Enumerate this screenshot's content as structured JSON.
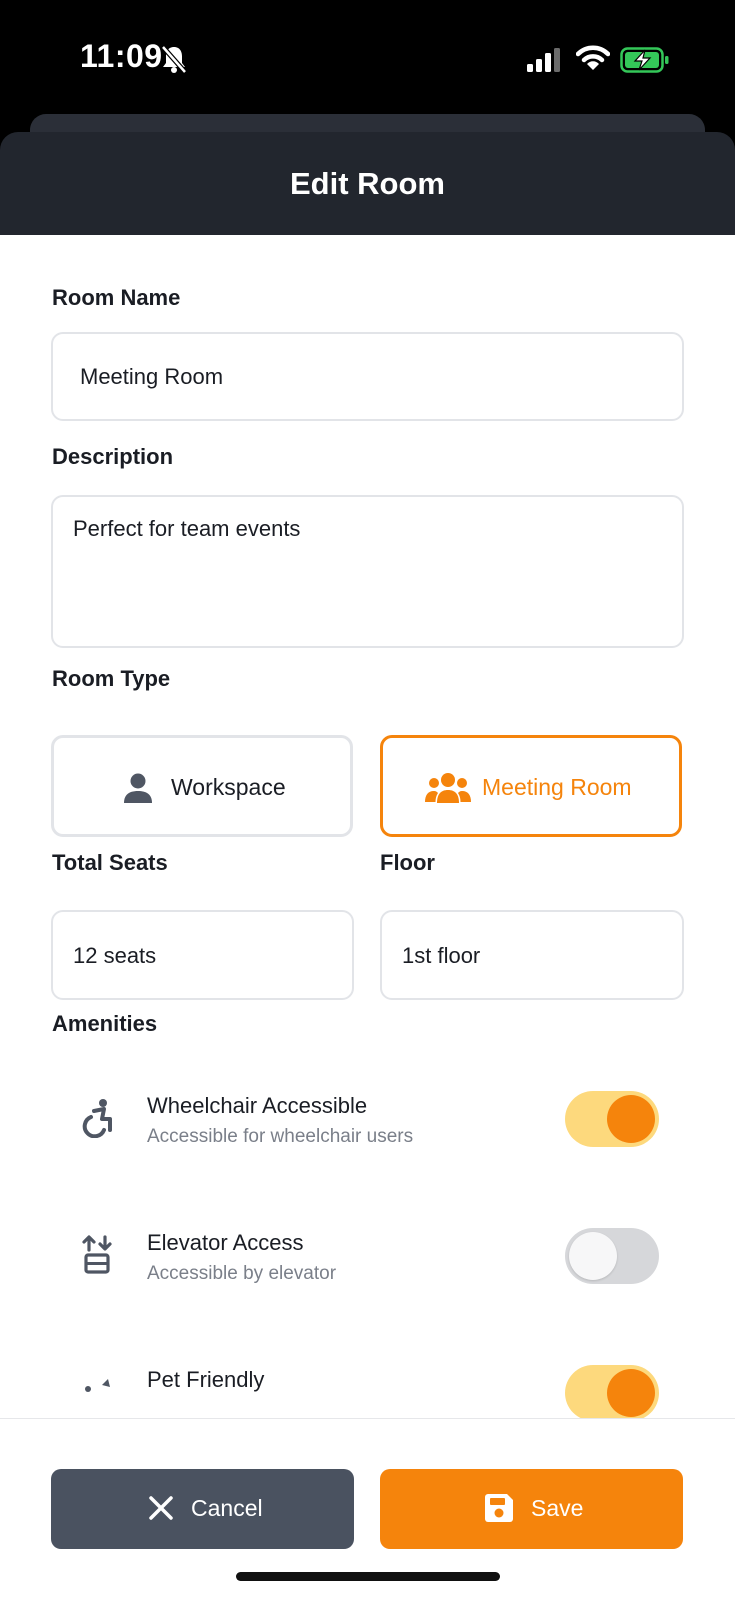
{
  "status_bar": {
    "time": "11:09"
  },
  "header": {
    "title": "Edit Room"
  },
  "form": {
    "room_name": {
      "label": "Room Name",
      "value": "Meeting Room"
    },
    "description": {
      "label": "Description",
      "value": "Perfect for team events"
    },
    "room_type": {
      "label": "Room Type",
      "options": [
        {
          "label": "Workspace",
          "icon": "person-icon",
          "selected": false
        },
        {
          "label": "Meeting Room",
          "icon": "group-icon",
          "selected": true
        }
      ]
    },
    "total_seats": {
      "label": "Total Seats",
      "value": "12 seats"
    },
    "floor": {
      "label": "Floor",
      "value": "1st floor"
    }
  },
  "amenities": {
    "label": "Amenities",
    "items": [
      {
        "title": "Wheelchair Accessible",
        "description": "Accessible for wheelchair users",
        "icon": "wheelchair-icon",
        "enabled": true
      },
      {
        "title": "Elevator Access",
        "description": "Accessible by elevator",
        "icon": "elevator-icon",
        "enabled": false
      },
      {
        "title": "Pet Friendly",
        "description": "",
        "icon": "pet-icon",
        "enabled": true
      }
    ]
  },
  "footer": {
    "cancel_label": "Cancel",
    "save_label": "Save"
  },
  "colors": {
    "accent": "#f5840c",
    "header_bg": "#22262e",
    "cancel_bg": "#4a5260",
    "toggle_on_track": "#fdd97d"
  }
}
